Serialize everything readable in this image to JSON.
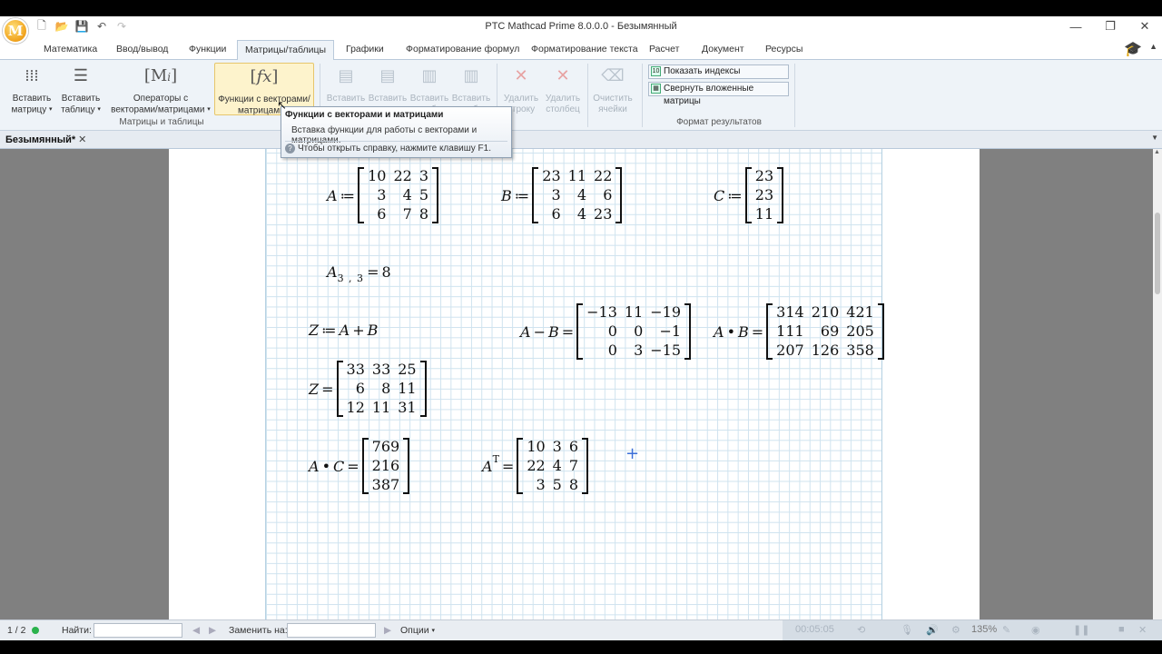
{
  "window": {
    "title": "PTC Mathcad Prime 8.0.0.0 - Безымянный",
    "logo_letter": "M",
    "controls": {
      "minimize": "—",
      "restore": "❐",
      "close": "✕"
    }
  },
  "ribbon_tabs": [
    "Математика",
    "Ввод/вывод",
    "Функции",
    "Матрицы/таблицы",
    "Графики",
    "Форматирование формул",
    "Форматирование текста",
    "Расчет",
    "Документ",
    "Ресурсы"
  ],
  "ribbon": {
    "insert_matrix": "Вставить матрицу",
    "insert_table": "Вставить таблицу",
    "operators": "Операторы с векторами/матрицами",
    "functions": "Функции с векторами/ матрицами",
    "insert_row_before": "Вставить строку",
    "insert_row_after": "Вставить строку",
    "insert_col_before": "Вставить столбец",
    "insert_col_after": "Вставить столбец",
    "delete_row": "Удалить строку",
    "delete_col": "Удалить столбец",
    "clear_cells": "Очистить ячейки",
    "group_matrices": "Матрицы и таблицы",
    "show_indices": "Показать индексы",
    "collapse_nested": "Свернуть вложенные матрицы",
    "group_format": "Формат результатов"
  },
  "tooltip": {
    "title": "Функции с векторами и матрицами",
    "body": "Вставка функции для работы с векторами и матрицами.",
    "help": "Чтобы открыть справку, нажмите клавишу F1."
  },
  "document_tab": "Безымянный*",
  "math": {
    "A": [
      [
        "10",
        "22",
        "3"
      ],
      [
        "3",
        "4",
        "5"
      ],
      [
        "6",
        "7",
        "8"
      ]
    ],
    "B": [
      [
        "23",
        "11",
        "22"
      ],
      [
        "3",
        "4",
        "6"
      ],
      [
        "6",
        "4",
        "23"
      ]
    ],
    "C": [
      [
        "23"
      ],
      [
        "23"
      ],
      [
        "11"
      ]
    ],
    "A33_value": "8",
    "A_minus_B": [
      [
        "−13",
        "11",
        "−19"
      ],
      [
        "0",
        "0",
        "−1"
      ],
      [
        "0",
        "3",
        "−15"
      ]
    ],
    "A_times_B": [
      [
        "314",
        "210",
        "421"
      ],
      [
        "111",
        "69",
        "205"
      ],
      [
        "207",
        "126",
        "358"
      ]
    ],
    "Z": [
      [
        "33",
        "33",
        "25"
      ],
      [
        "6",
        "8",
        "11"
      ],
      [
        "12",
        "11",
        "31"
      ]
    ],
    "A_times_C": [
      [
        "769"
      ],
      [
        "216"
      ],
      [
        "387"
      ]
    ],
    "A_transpose": [
      [
        "10",
        "3",
        "6"
      ],
      [
        "22",
        "4",
        "7"
      ],
      [
        "3",
        "5",
        "8"
      ]
    ]
  },
  "status": {
    "page": "1 / 2",
    "find_label": "Найти:",
    "replace_label": "Заменить на:",
    "options": "Опции",
    "time": "00:05:05",
    "zoom": "135%"
  }
}
